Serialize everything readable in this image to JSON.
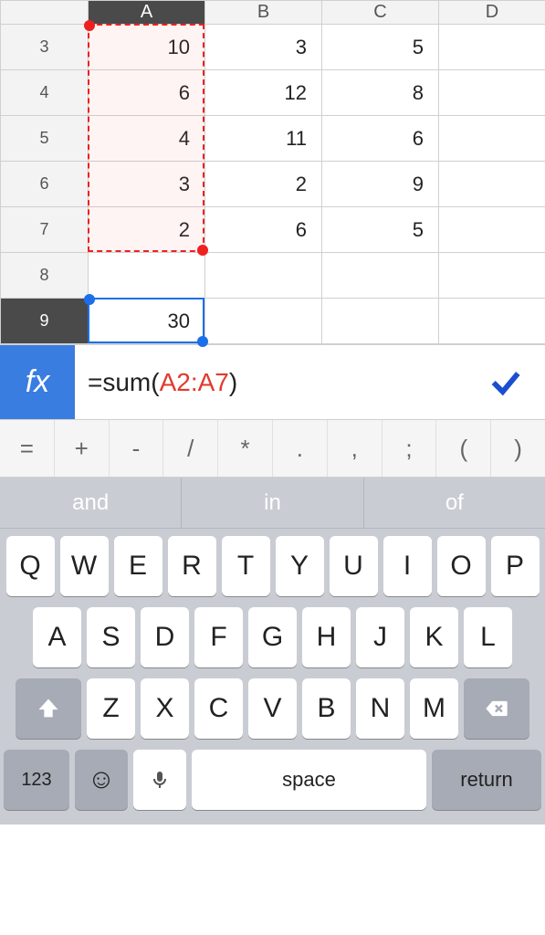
{
  "columns": [
    "A",
    "B",
    "C",
    "D"
  ],
  "rows": [
    {
      "num": "3",
      "A": "10",
      "B": "3",
      "C": "5",
      "D": ""
    },
    {
      "num": "4",
      "A": "6",
      "B": "12",
      "C": "8",
      "D": ""
    },
    {
      "num": "5",
      "A": "4",
      "B": "11",
      "C": "6",
      "D": ""
    },
    {
      "num": "6",
      "A": "3",
      "B": "2",
      "C": "9",
      "D": ""
    },
    {
      "num": "7",
      "A": "2",
      "B": "6",
      "C": "5",
      "D": ""
    },
    {
      "num": "8",
      "A": "",
      "B": "",
      "C": "",
      "D": ""
    },
    {
      "num": "9",
      "A": "30",
      "B": "",
      "C": "",
      "D": ""
    }
  ],
  "active_column": "A",
  "active_row": "9",
  "formula": {
    "prefix": "=sum(",
    "ref": "A2:A7",
    "suffix": ")"
  },
  "fx_label": "fx",
  "symbols": [
    "=",
    "+",
    "-",
    "/",
    "*",
    ".",
    ",",
    ";",
    "(",
    ")"
  ],
  "suggestions": [
    "and",
    "in",
    "of"
  ],
  "keyboard": {
    "row1": [
      "Q",
      "W",
      "E",
      "R",
      "T",
      "Y",
      "U",
      "I",
      "O",
      "P"
    ],
    "row2": [
      "A",
      "S",
      "D",
      "F",
      "G",
      "H",
      "J",
      "K",
      "L"
    ],
    "row3": [
      "Z",
      "X",
      "C",
      "V",
      "B",
      "N",
      "M"
    ],
    "num_label": "123",
    "space_label": "space",
    "return_label": "return"
  },
  "colors": {
    "accent_blue": "#3a7de0",
    "range_red": "#ee2020"
  }
}
